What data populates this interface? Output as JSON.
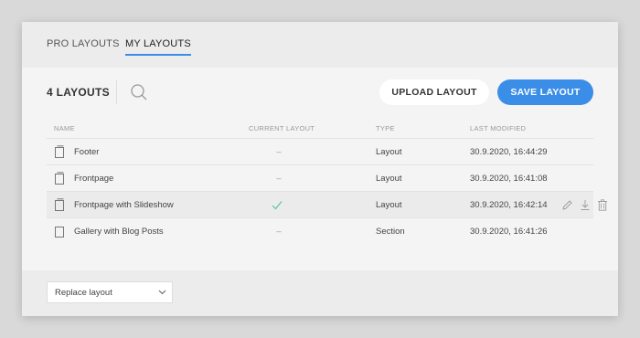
{
  "tabs": [
    {
      "label": "PRO LAYOUTS",
      "active": false
    },
    {
      "label": "MY LAYOUTS",
      "active": true
    }
  ],
  "toolbar": {
    "count_label": "4 LAYOUTS",
    "upload_label": "UPLOAD LAYOUT",
    "save_label": "SAVE LAYOUT"
  },
  "table": {
    "headers": {
      "name": "NAME",
      "current": "CURRENT LAYOUT",
      "type": "TYPE",
      "modified": "LAST MODIFIED"
    },
    "rows": [
      {
        "name": "Footer",
        "current": "–",
        "type": "Layout",
        "modified": "30.9.2020, 16:44:29"
      },
      {
        "name": "Frontpage",
        "current": "–",
        "type": "Layout",
        "modified": "30.9.2020, 16:41:08"
      },
      {
        "name": "Frontpage with Slideshow",
        "current": "",
        "type": "Layout",
        "modified": "30.9.2020, 16:42:14"
      },
      {
        "name": "Gallery with Blog Posts",
        "current": "–",
        "type": "Section",
        "modified": "30.9.2020, 16:41:26"
      }
    ]
  },
  "footer": {
    "select_value": "Replace layout"
  },
  "colors": {
    "accent": "#3b8ee8",
    "check": "#5cc49a"
  }
}
